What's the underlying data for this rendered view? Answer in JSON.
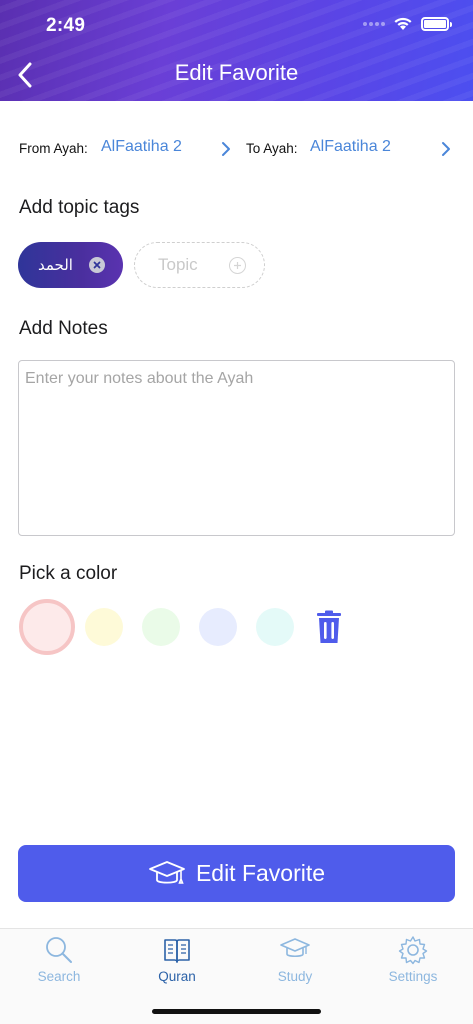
{
  "status_bar": {
    "time": "2:49"
  },
  "nav": {
    "title": "Edit Favorite",
    "back_icon": "chevron-left-icon"
  },
  "range": {
    "from_label": "From Ayah:",
    "from_value": "AlFaatiha 2",
    "to_label": "To Ayah:",
    "to_value": "AlFaatiha 2"
  },
  "tags": {
    "title": "Add topic tags",
    "items": [
      {
        "label": "الحمد"
      }
    ],
    "add_placeholder": "Topic"
  },
  "notes": {
    "title": "Add Notes",
    "placeholder": "Enter your notes about the Ayah",
    "value": ""
  },
  "colors": {
    "title": "Pick a color",
    "swatches": [
      "#fdeaea",
      "#fefad8",
      "#eafbe8",
      "#e7ecfe",
      "#e4faf8"
    ],
    "selected_index": 0,
    "delete_icon": "trash-icon"
  },
  "primary_button": {
    "label": "Edit Favorite",
    "icon": "graduation-cap-icon"
  },
  "tabbar": {
    "items": [
      {
        "label": "Search",
        "icon": "search-icon"
      },
      {
        "label": "Quran",
        "icon": "book-icon",
        "active": true
      },
      {
        "label": "Study",
        "icon": "graduation-cap-icon"
      },
      {
        "label": "Settings",
        "icon": "gear-icon"
      }
    ]
  },
  "theme": {
    "accent": "#4f5ceb",
    "link": "#4a86d9",
    "tab_active": "#2c62a8",
    "tab_inactive": "#8db7df"
  }
}
